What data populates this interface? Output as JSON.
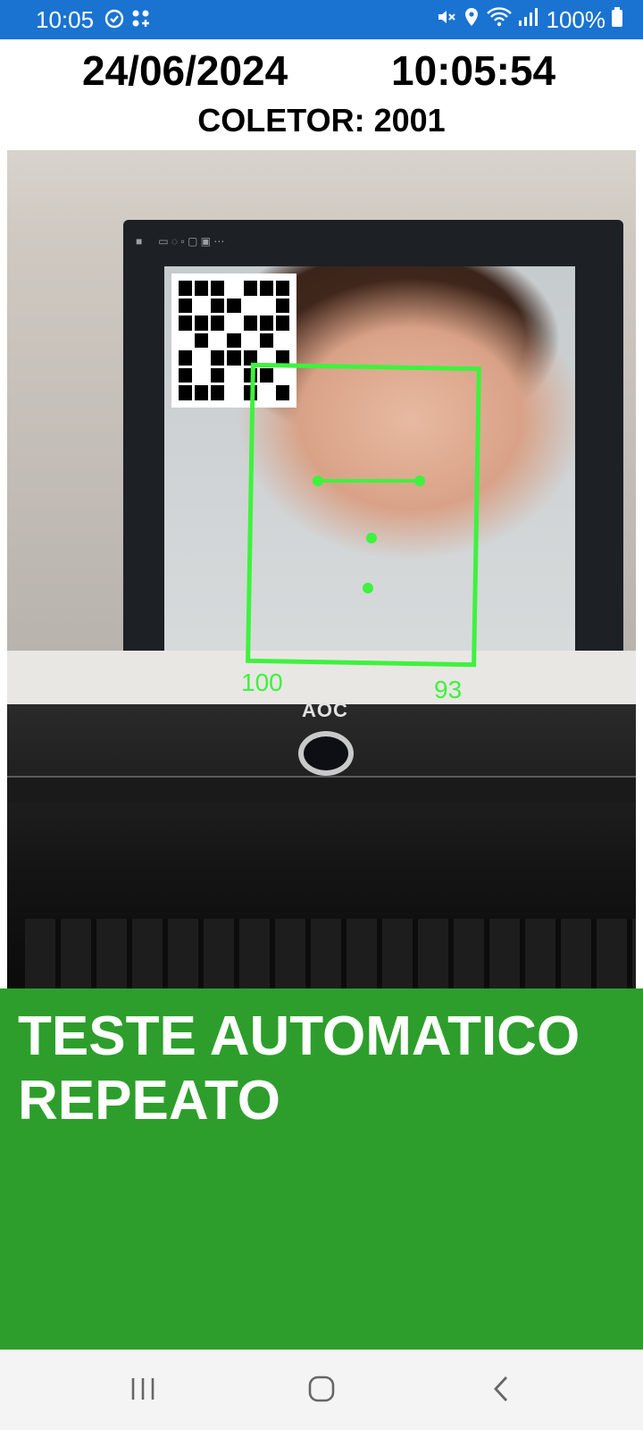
{
  "status_bar": {
    "time": "10:05",
    "battery": "100%"
  },
  "header": {
    "date": "24/06/2024",
    "clock": "10:05:54",
    "collector_label": "COLETOR: 2001"
  },
  "camera": {
    "score_left": "100",
    "score_right": "93",
    "monitor_brand": "AOC"
  },
  "result": {
    "line1": "TESTE AUTOMATICO",
    "line2": "REPEATO",
    "color": "#2d9e2c"
  },
  "accent": {
    "status_bar_color": "#1a73d1",
    "face_box_color": "#3ef23e"
  },
  "nav": {
    "icons": [
      "recent-apps-icon",
      "home-icon",
      "back-icon"
    ]
  }
}
